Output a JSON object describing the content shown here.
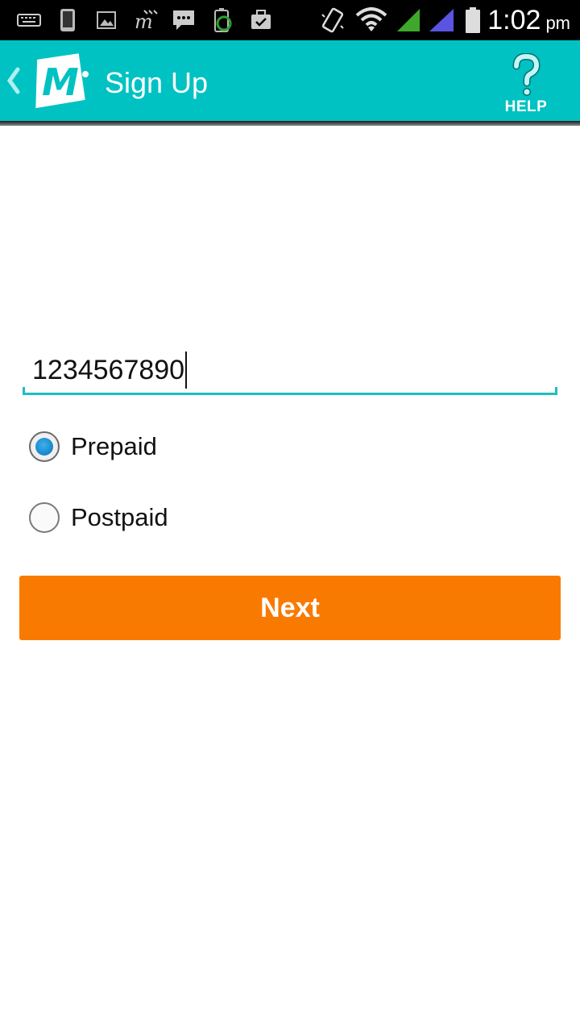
{
  "status_bar": {
    "time": "1:02",
    "ampm": "pm",
    "icons": [
      "keyboard-icon",
      "phone-device-icon",
      "image-icon",
      "mobikwik-notification-icon",
      "message-icon",
      "battery-saver-icon",
      "briefcase-icon",
      "vibrate-icon",
      "wifi-icon",
      "signal-sim1-icon",
      "signal-sim2-icon",
      "battery-icon"
    ],
    "colors": {
      "background": "#000000",
      "sim1": "#3fa82a",
      "sim2": "#5a55e0"
    }
  },
  "app_bar": {
    "title": "Sign Up",
    "help_label": "HELP",
    "logo_letter": "M",
    "icons": {
      "back": "chevron-left-icon",
      "help": "help-question-icon",
      "logo": "mobikwik-logo"
    },
    "colors": {
      "background": "#00c2c2",
      "logo_bg": "#ffffff"
    }
  },
  "form": {
    "phone_value": "1234567890",
    "options": [
      {
        "label": "Prepaid",
        "checked": true
      },
      {
        "label": "Postpaid",
        "checked": false
      }
    ],
    "next_label": "Next",
    "colors": {
      "underline": "#1fbfbf",
      "next_bg": "#f97a00",
      "radio_dot": "#1a8cd0"
    }
  }
}
